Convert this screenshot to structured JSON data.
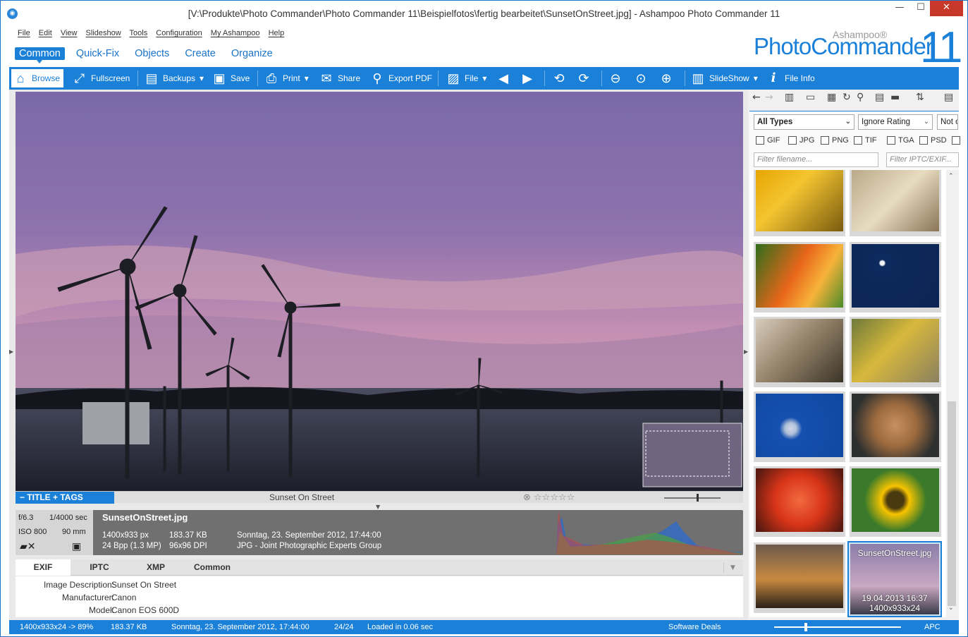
{
  "window": {
    "title": "[V:\\Produkte\\Photo Commander\\Photo Commander 11\\Beispielfotos\\fertig bearbeitet\\SunsetOnStreet.jpg] - Ashampoo Photo Commander 11",
    "min_icon": "minimize-icon",
    "max_icon": "maximize-icon",
    "close_icon": "close-icon"
  },
  "menu": [
    "File",
    "Edit",
    "View",
    "Slideshow",
    "Tools",
    "Configuration",
    "My Ashampoo",
    "Help"
  ],
  "ribbon_tabs": [
    "Common",
    "Quick-Fix",
    "Objects",
    "Create",
    "Organize"
  ],
  "logo": {
    "brand": "Ashampoo®",
    "name": "PhotoCommander",
    "version": "11"
  },
  "toolbar": {
    "browse": "Browse",
    "fullscreen": "Fullscreen",
    "backups": "Backups",
    "save": "Save",
    "print": "Print",
    "share": "Share",
    "export_pdf": "Export PDF",
    "file": "File",
    "slideshow": "SlideShow",
    "file_info": "File Info"
  },
  "viewer": {
    "title_button": "− TITLE  + TAGS",
    "photo_title": "Sunset On Street",
    "rating_stars": "☆☆☆☆☆"
  },
  "info": {
    "aperture": "f/6.3",
    "shutter": "1/4000 sec",
    "iso": "ISO 800",
    "focal": "90 mm",
    "filename": "SunsetOnStreet.jpg",
    "dimensions": "1400x933 px",
    "filesize": "183.37 KB",
    "bpp": "24 Bpp (1.3 MP)",
    "dpi": "96x96 DPI",
    "date": "Sonntag, 23. September 2012, 17:44:00",
    "format": "JPG - Joint Photographic Experts Group"
  },
  "meta_tabs": [
    "EXIF",
    "IPTC",
    "XMP",
    "Common"
  ],
  "meta_rows": [
    {
      "key": "Image Description:",
      "value": "Sunset On Street"
    },
    {
      "key": "Manufacturer:",
      "value": "Canon"
    },
    {
      "key": "Model:",
      "value": "Canon EOS 600D"
    }
  ],
  "browser": {
    "type_filter": "All Types",
    "rating_filter": "Ignore Rating",
    "other_filter": "Not o",
    "formats": [
      "GIF",
      "JPG",
      "PNG",
      "TIF",
      "TGA",
      "PSD"
    ],
    "filename_placeholder": "Filter filename...",
    "iptc_placeholder": "Filter IPTC/EXIF...",
    "selected_caption": "SunsetOnStreet.jpg",
    "selected_date": "19.04.2013 16:37",
    "selected_size": "1400x933x24"
  },
  "status": {
    "zoom": "1400x933x24 -> 89%",
    "size": "183.37 KB",
    "date": "Sonntag, 23. September 2012, 17:44:00",
    "count": "24/24",
    "loaded": "Loaded in 0.06 sec",
    "deals": "Software Deals",
    "apc": "APC"
  },
  "colors": {
    "accent": "#1a80d8",
    "close": "#c7372a"
  }
}
